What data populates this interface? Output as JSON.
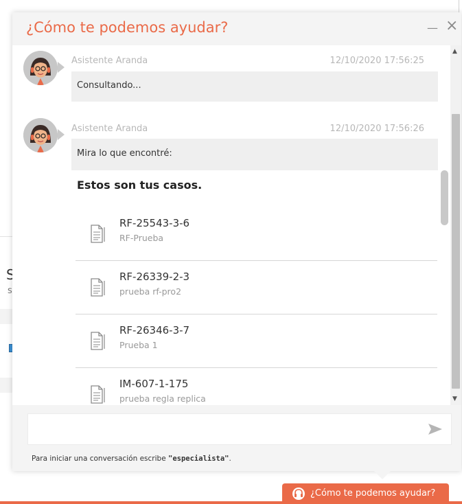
{
  "chat": {
    "title": "¿Cómo te podemos ayudar?",
    "minimize_label": "—",
    "close_label": "×"
  },
  "messages": [
    {
      "sender": "Asistente Aranda",
      "timestamp": "12/10/2020 17:56:25",
      "text": "Consultando..."
    },
    {
      "sender": "Asistente Aranda",
      "timestamp": "12/10/2020 17:56:26",
      "text": "Mira lo que encontré:"
    }
  ],
  "cases_title": "Estos son tus casos.",
  "cases": [
    {
      "id": "RF-25543-3-6",
      "description": "RF-Prueba"
    },
    {
      "id": "RF-26339-2-3",
      "description": "prueba rf-pro2"
    },
    {
      "id": "RF-26346-3-7",
      "description": "Prueba 1"
    },
    {
      "id": "IM-607-1-175",
      "description": "prueba regla replica"
    }
  ],
  "input": {
    "value": "",
    "placeholder": ""
  },
  "hint": {
    "prefix": "Para iniciar una conversación escribe ",
    "keyword": "\"especialista\"",
    "suffix": "."
  },
  "launcher": {
    "label": "¿Cómo te podemos ayudar?"
  },
  "background": {
    "fragment_1": "S",
    "fragment_2": "s"
  },
  "icons": {
    "avatar": "assistant-avatar-icon",
    "case": "document-icon",
    "send": "send-arrow-icon",
    "launcher": "headset-icon"
  },
  "colors": {
    "accent": "#ea6a48",
    "header_bg": "#f4f4f4",
    "bubble_bg": "#efefef",
    "meta_text": "#b7b7b7"
  }
}
